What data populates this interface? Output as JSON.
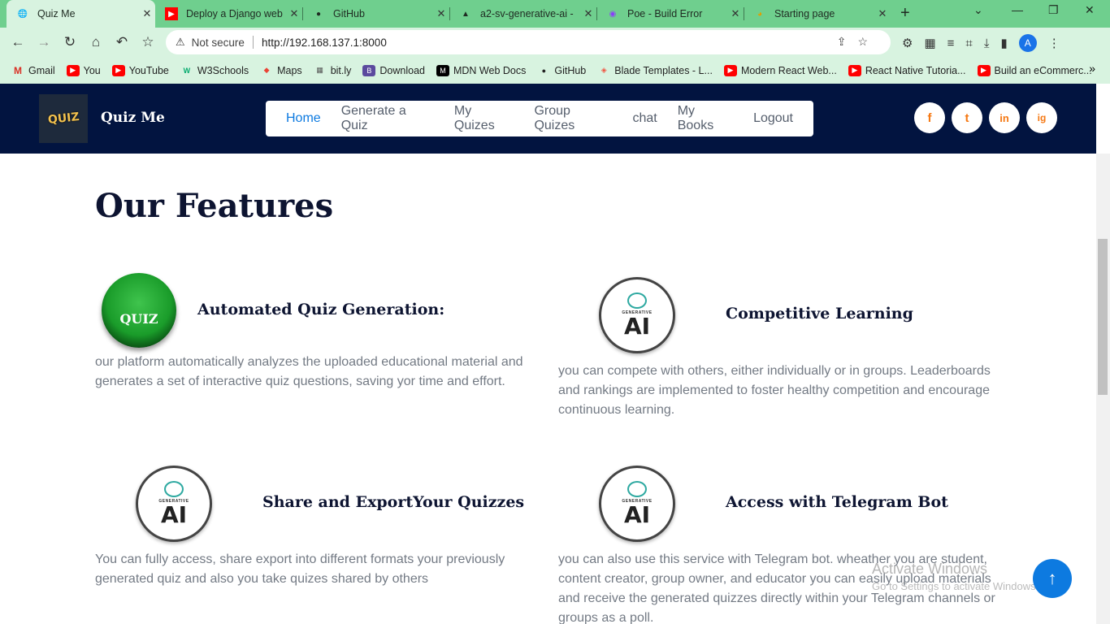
{
  "browser": {
    "tabs": [
      {
        "title": "Quiz Me",
        "icon": "globe-icon"
      },
      {
        "title": "Deploy a Django web",
        "icon": "youtube-icon"
      },
      {
        "title": "GitHub",
        "icon": "github-icon"
      },
      {
        "title": "a2-sv-generative-ai -",
        "icon": "triangle-icon"
      },
      {
        "title": "Poe - Build Error",
        "icon": "poe-icon"
      },
      {
        "title": "Starting page",
        "icon": "chrome-icon"
      }
    ],
    "address": {
      "security": "Not secure",
      "url": "http://192.168.137.1:8000"
    },
    "profile_initial": "A",
    "bookmarks": [
      "Gmail",
      "You",
      "YouTube",
      "W3Schools",
      "Maps",
      "bit.ly",
      "Download",
      "MDN Web Docs",
      "GitHub",
      "Blade Templates - L...",
      "Modern React Web...",
      "React Native Tutoria...",
      "Build an eCommerc..."
    ]
  },
  "site": {
    "logo_text": "QUIZ",
    "brand": "Quiz Me",
    "nav": [
      "Home",
      "Generate a Quiz",
      "My Quizes",
      "Group Quizes",
      "chat",
      "My Books",
      "Logout"
    ],
    "social": [
      "f",
      "t",
      "in",
      "ig"
    ]
  },
  "features": {
    "title": "Our Features",
    "items": [
      {
        "heading": "Automated Quiz Generation:",
        "text": "our platform automatically analyzes the uploaded educational material and generates a set of interactive quiz questions, saving yor time and effort."
      },
      {
        "heading": "Competitive Learning",
        "text": "you can compete with others, either individually or in groups. Leaderboards and rankings are implemented to foster healthy competition and encourage continuous learning."
      },
      {
        "heading": "Share and ExportYour Quizzes",
        "text": "You can fully access, share export into different formats your previously generated quiz and also you take quizes shared by others"
      },
      {
        "heading": "Access with Telegram Bot",
        "text": "you can also use this service with Telegram bot. wheather you are student, content creator, group owner, and educator you can easily upload materials and receive the generated quizzes directly within your Telegram channels or groups as a poll."
      }
    ],
    "badge_small": "GENERATIVE",
    "badge_big": "AI",
    "quiz_ball_text": "QUIZ"
  },
  "watermark": {
    "line1": "Activate Windows",
    "line2": "Go to Settings to activate Windows."
  }
}
